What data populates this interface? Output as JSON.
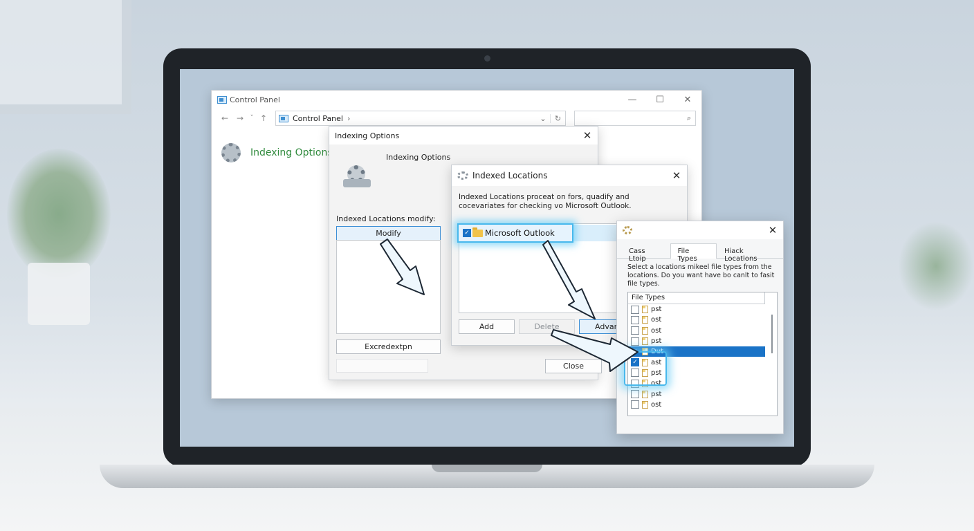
{
  "control_panel": {
    "title": "Control Panel",
    "nav": {
      "back": "←",
      "forward": "→",
      "recent": "˅",
      "up": "↑"
    },
    "breadcrumb": [
      "Control Panel"
    ],
    "breadcrumb_sep": "›",
    "dropdown": "⌄",
    "refresh": "↻",
    "search_icon": "⌕",
    "minimize": "—",
    "maximize": "☐",
    "close": "✕",
    "heading": "Indexing Options"
  },
  "indexing_options": {
    "title": "Indexing Options",
    "close": "✕",
    "header": "Indexing Options",
    "locations_label": "Indexed Locations modify:",
    "modify_button": "Modify",
    "exclusion_button": "Excredextpn"
  },
  "indexed_locations": {
    "title": "Indexed Locations",
    "close": "✕",
    "description": "Indexed Locations proceat on fors, quadify and cocevariates for checking vo Microsoft Outlook.",
    "items": [
      {
        "label": "Microsoft Outlook",
        "checked": true
      }
    ],
    "add_button": "Add",
    "delete_button": "Delete",
    "advanced_button": "Advan",
    "close_button": "Close"
  },
  "file_types_dialog": {
    "close": "✕",
    "tabs": [
      {
        "label": "Cass Ltoip",
        "active": false
      },
      {
        "label": "File Types",
        "active": true
      },
      {
        "label": "Hiack Locatlons",
        "active": false
      }
    ],
    "description": "Select a locations mikeel file types from the locations.  Do you want have bo canlt to fasit file types.",
    "list_header": "File Types",
    "rows": [
      {
        "ext": "pst",
        "checked": false,
        "selected": false
      },
      {
        "ext": "ost",
        "checked": false,
        "selected": false
      },
      {
        "ext": "ost",
        "checked": false,
        "selected": false
      },
      {
        "ext": "pst",
        "checked": false,
        "selected": false
      },
      {
        "ext": "Dut",
        "checked": true,
        "selected": true
      },
      {
        "ext": "ast",
        "checked": true,
        "selected": false
      },
      {
        "ext": "pst",
        "checked": false,
        "selected": false
      },
      {
        "ext": "ost",
        "checked": false,
        "selected": false
      },
      {
        "ext": "pst",
        "checked": false,
        "selected": false
      },
      {
        "ext": "ost",
        "checked": false,
        "selected": false
      }
    ]
  },
  "colors": {
    "accent": "#1a73c7",
    "highlight_glow": "#48b8ec",
    "heading_green": "#2f8a3c"
  }
}
